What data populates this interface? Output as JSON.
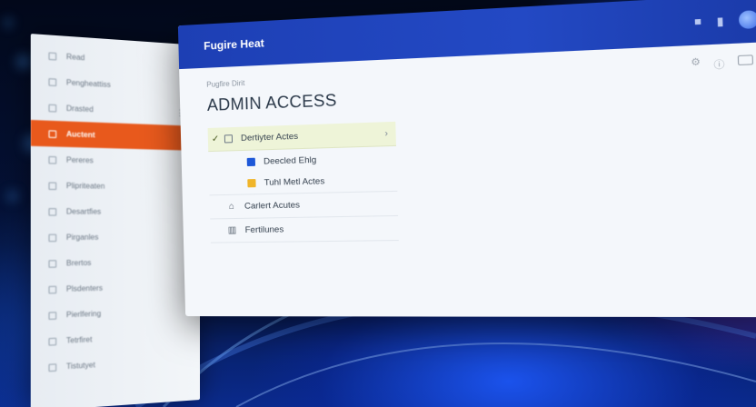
{
  "window": {
    "title": "Fugire Heat",
    "breadcrumb": "Pugfire Dirit",
    "page_title": "ADMIN ACCESS"
  },
  "sidebar": {
    "items": [
      {
        "label": "Read"
      },
      {
        "label": "Pengheattiss"
      },
      {
        "label": "Drasted"
      },
      {
        "label": "Auctent",
        "active": true
      },
      {
        "label": "Pereres"
      },
      {
        "label": "Plipriteaten"
      },
      {
        "label": "Desartfies"
      },
      {
        "label": "Pirganles"
      },
      {
        "label": "Brertos"
      },
      {
        "label": "Plsdenters"
      },
      {
        "label": "Pierlfering"
      },
      {
        "label": "Tetrfiret"
      },
      {
        "label": "Tistutyet"
      }
    ]
  },
  "tree": {
    "parent": {
      "label": "Dertiyter Actes"
    },
    "children": [
      {
        "label": "Deecled Ehlg",
        "color": "#1e58d8"
      },
      {
        "label": "Tuhl Metl Actes",
        "color": "#f0b52a"
      }
    ],
    "items": [
      {
        "label": "Carlert Acutes",
        "icon": "building-icon"
      },
      {
        "label": "Fertilunes",
        "icon": "grid-icon"
      }
    ]
  },
  "colors": {
    "titlebar": "#1d3fb4",
    "active_sidebar": "#e8591c",
    "selected_row": "#eef4d8"
  }
}
